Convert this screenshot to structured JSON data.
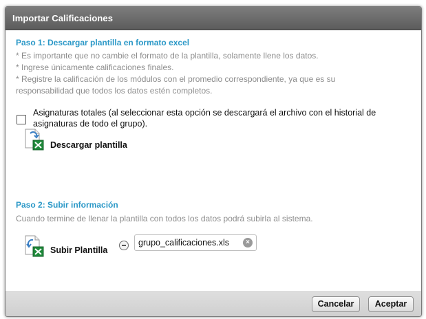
{
  "dialog": {
    "title": "Importar Calificaciones"
  },
  "step1": {
    "title": "Paso 1: Descargar plantilla en formato excel",
    "notes": [
      "* Es importante que no cambie el formato de la plantilla, solamente llene los datos.",
      "* Ingrese únicamente calificaciones finales.",
      "* Registre la calificación de los módulos con el promedio correspondiente, ya que es su",
      "responsabilidad que todos los datos estén completos."
    ],
    "checkbox_label_line1": "Asignaturas totales (al seleccionar esta opción se descargará el archivo con el historial de",
    "checkbox_label_line2": "asignaturas de todo el grupo).",
    "download_label": "Descargar plantilla"
  },
  "step2": {
    "title": "Paso 2: Subir información",
    "description": "Cuando termine de llenar la plantilla con todos los datos podrá subirla al sistema.",
    "upload_label": "Subir Plantilla",
    "file_name": "grupo_calificaciones.xls"
  },
  "footer": {
    "cancel_label": "Cancelar",
    "accept_label": "Aceptar"
  },
  "colors": {
    "accent": "#2b98c7",
    "titlebar": "#6a6a6a",
    "excel_green": "#1f8a3b"
  }
}
